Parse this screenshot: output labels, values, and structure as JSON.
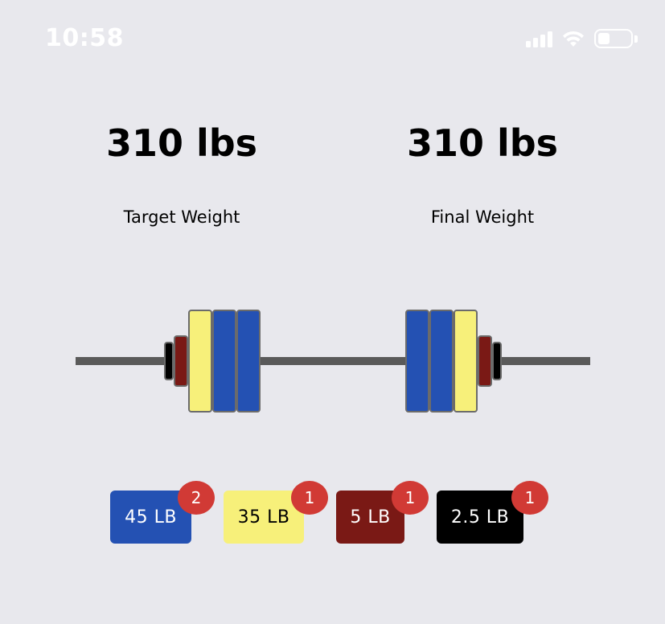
{
  "status_bar": {
    "time": "10:58",
    "icons": [
      "cellular-signal-icon",
      "wifi-icon",
      "battery-icon"
    ]
  },
  "target": {
    "value": "310 lbs",
    "label": "Target Weight"
  },
  "final": {
    "value": "310 lbs",
    "label": "Final Weight"
  },
  "plates": [
    {
      "label": "45 LB",
      "count": "2",
      "color": "#2451b3",
      "text_color": "#ffffff"
    },
    {
      "label": "35 LB",
      "count": "1",
      "color": "#f7f07a",
      "text_color": "#000000"
    },
    {
      "label": "5 LB",
      "count": "1",
      "color": "#7a1915",
      "text_color": "#ffffff"
    },
    {
      "label": "2.5 LB",
      "count": "1",
      "color": "#000000",
      "text_color": "#ffffff"
    }
  ],
  "colors": {
    "background": "#e8e8ed",
    "bar": "#5a5a5a",
    "badge": "#d13a35"
  }
}
